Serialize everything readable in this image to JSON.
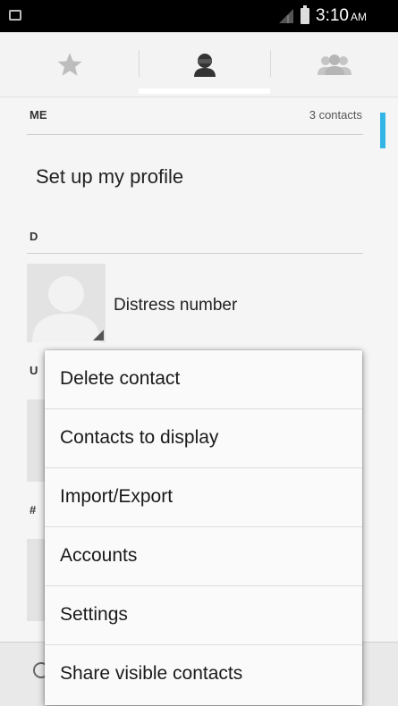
{
  "status_bar": {
    "time": "3:10",
    "ampm": "AM"
  },
  "tabs": [
    {
      "icon": "star-icon"
    },
    {
      "icon": "person-icon",
      "selected": true
    },
    {
      "icon": "group-icon"
    }
  ],
  "list": {
    "me_header": "ME",
    "me_count": "3 contacts",
    "setup_profile": "Set up my profile",
    "section_d": "D",
    "contact_distress": "Distress number",
    "section_u": "U",
    "section_hash": "#"
  },
  "menu": {
    "items": [
      "Delete contact",
      "Contacts to display",
      "Import/Export",
      "Accounts",
      "Settings",
      "Share visible contacts"
    ]
  },
  "colors": {
    "accent": "#33b5e5",
    "status_bar": "#000000",
    "background": "#f5f5f5"
  }
}
